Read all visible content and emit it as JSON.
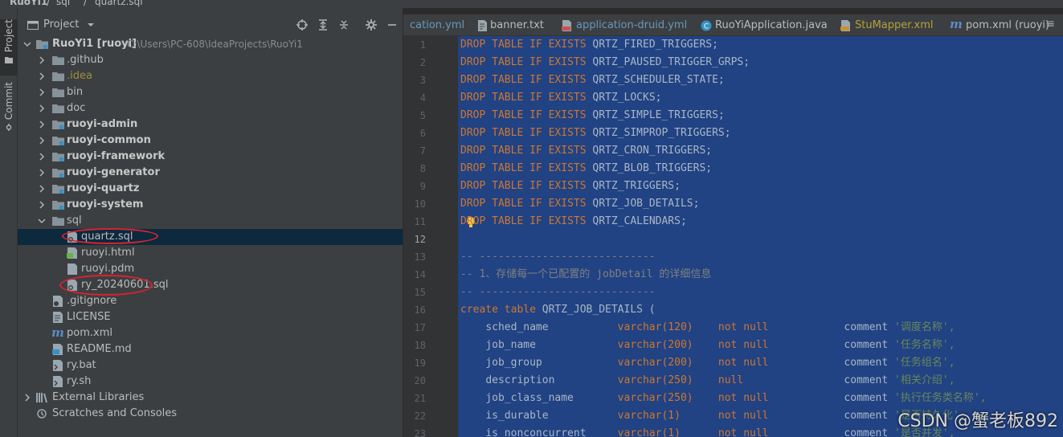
{
  "breadcrumb": {
    "project": "RuoYi1",
    "folder": "sql",
    "file": "quartz.sql"
  },
  "left_strip": {
    "project_tab": "Project",
    "commit_tab": "Commit"
  },
  "panel": {
    "title": "Project"
  },
  "tree": [
    {
      "label": "RuoYi1 [ruoyi]",
      "path": "C:\\Users\\PC-608\\IdeaProjects\\RuoYi1"
    },
    {
      "label": ".github"
    },
    {
      "label": ".idea"
    },
    {
      "label": "bin"
    },
    {
      "label": "doc"
    },
    {
      "label": "ruoyi-admin"
    },
    {
      "label": "ruoyi-common"
    },
    {
      "label": "ruoyi-framework"
    },
    {
      "label": "ruoyi-generator"
    },
    {
      "label": "ruoyi-quartz"
    },
    {
      "label": "ruoyi-system"
    },
    {
      "label": "sql"
    },
    {
      "label": "quartz.sql"
    },
    {
      "label": "ruoyi.html"
    },
    {
      "label": "ruoyi.pdm"
    },
    {
      "label": "ry_20240601.sql"
    },
    {
      "label": ".gitignore"
    },
    {
      "label": "LICENSE"
    },
    {
      "label": "pom.xml"
    },
    {
      "label": "README.md"
    },
    {
      "label": "ry.bat"
    },
    {
      "label": "ry.sh"
    },
    {
      "label": "External Libraries"
    },
    {
      "label": "Scratches and Consoles"
    }
  ],
  "editor_tabs": [
    {
      "label": "cation.yml"
    },
    {
      "label": "banner.txt"
    },
    {
      "label": "application-druid.yml"
    },
    {
      "label": "RuoYiApplication.java"
    },
    {
      "label": "StuMapper.xml"
    },
    {
      "label": "pom.xml (ruoyi)"
    }
  ],
  "tabs_menu": "≡",
  "line_numbers": [
    "1",
    "2",
    "3",
    "4",
    "5",
    "6",
    "7",
    "8",
    "9",
    "10",
    "11",
    "12",
    "13",
    "14",
    "15",
    "16",
    "17",
    "18",
    "19",
    "20",
    "21",
    "22",
    "23"
  ],
  "code": {
    "drop": "DROP",
    "table": "TABLE",
    "if": "IF",
    "exists": "EXISTS",
    "drop_targets": [
      "QRTZ_FIRED_TRIGGERS;",
      "QRTZ_PAUSED_TRIGGER_GRPS;",
      "QRTZ_SCHEDULER_STATE;",
      "QRTZ_LOCKS;",
      "QRTZ_SIMPLE_TRIGGERS;",
      "QRTZ_SIMPROP_TRIGGERS;",
      "QRTZ_CRON_TRIGGERS;",
      "QRTZ_BLOB_TRIGGERS;",
      "QRTZ_TRIGGERS;",
      "QRTZ_JOB_DETAILS;",
      "QRTZ_CALENDARS;"
    ],
    "comment_rule": "-- ----------------------------",
    "comment_desc": "-- 1、存储每一个已配置的 jobDetail 的详细信息",
    "create_kw": "create table",
    "create_name": "QRTZ_JOB_DETAILS (",
    "columns": [
      {
        "name": "sched_name",
        "type": "varchar(120)",
        "nullity": "not null",
        "comment_kw": "comment",
        "comment": "'调度名称',"
      },
      {
        "name": "job_name",
        "type": "varchar(200)",
        "nullity": "not null",
        "comment_kw": "comment",
        "comment": "'任务名称',"
      },
      {
        "name": "job_group",
        "type": "varchar(200)",
        "nullity": "not null",
        "comment_kw": "comment",
        "comment": "'任务组名',"
      },
      {
        "name": "description",
        "type": "varchar(250)",
        "nullity": "null",
        "comment_kw": "comment",
        "comment": "'相关介绍',"
      },
      {
        "name": "job_class_name",
        "type": "varchar(250)",
        "nullity": "not null",
        "comment_kw": "comment",
        "comment": "'执行任务类名称',"
      },
      {
        "name": "is_durable",
        "type": "varchar(1)",
        "nullity": "not null",
        "comment_kw": "comment",
        "comment": "'是否持久化',"
      },
      {
        "name": "is_nonconcurrent",
        "type": "varchar(1)",
        "nullity": "not null",
        "comment_kw": "comment",
        "comment": "'是否并发',"
      }
    ]
  },
  "watermark": "CSDN @蟹老板892",
  "colors": {
    "selection": "#214283",
    "keyword": "#cc7832",
    "string": "#6a8759",
    "comment": "#808080",
    "annotation_red": "#d9232f"
  }
}
